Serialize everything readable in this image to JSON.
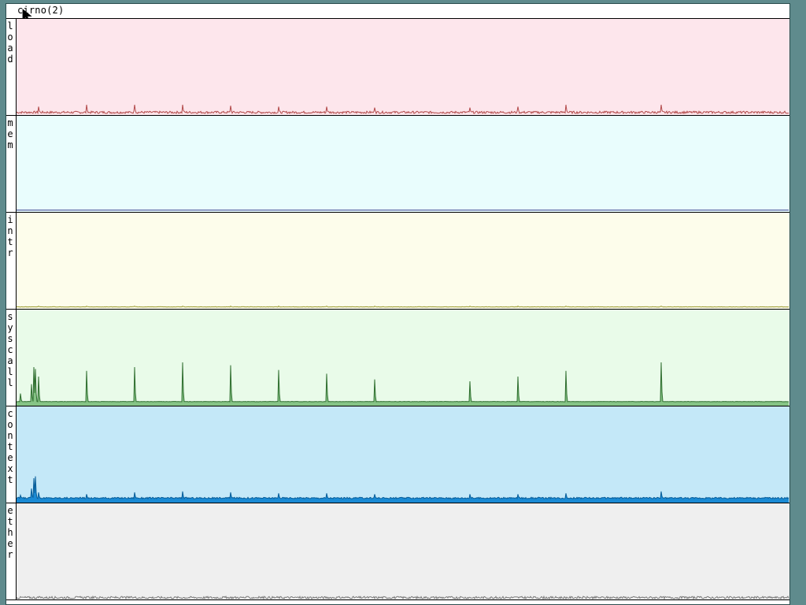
{
  "window": {
    "title": "cirno(2)"
  },
  "colors": {
    "desktop": "#5f8b8d",
    "load": {
      "bg": "#fde6ec",
      "line": "#b24a4a"
    },
    "mem": {
      "bg": "#e9fdfd",
      "line": "#3b3f8f"
    },
    "intr": {
      "bg": "#fdfdeb",
      "line": "#9a9a30"
    },
    "syscall": {
      "bg": "#e9fbe9",
      "line": "#2f6e2f",
      "fill": "#86c486"
    },
    "context": {
      "bg": "#c4e8f8",
      "line": "#0a5f9a",
      "fill": "#1a8ad4"
    },
    "ether": {
      "bg": "#efefef",
      "line": "#7a7a7a"
    }
  },
  "panels": [
    {
      "id": "load",
      "label": "load"
    },
    {
      "id": "mem",
      "label": "mem"
    },
    {
      "id": "intr",
      "label": "intr"
    },
    {
      "id": "syscall",
      "label": "syscall"
    },
    {
      "id": "context",
      "label": "context"
    },
    {
      "id": "ether",
      "label": "ether"
    }
  ],
  "chart_data": {
    "type": "area",
    "title": "cirno(2)",
    "series_count": 6,
    "x_samples": 982,
    "y_scale": "relative (0–1 of panel height)",
    "grid": false,
    "legend": "none",
    "series": [
      {
        "name": "load",
        "baseline": 0.02,
        "noise": 0.012,
        "spikes": [
          [
            28,
            0.08
          ],
          [
            89,
            0.1
          ],
          [
            150,
            0.1
          ],
          [
            211,
            0.1
          ],
          [
            272,
            0.09
          ],
          [
            333,
            0.08
          ],
          [
            394,
            0.08
          ],
          [
            455,
            0.07
          ],
          [
            576,
            0.07
          ],
          [
            637,
            0.08
          ],
          [
            698,
            0.1
          ],
          [
            819,
            0.1
          ]
        ]
      },
      {
        "name": "mem",
        "baseline": 0.01,
        "noise": 0.0,
        "spikes": []
      },
      {
        "name": "intr",
        "baseline": 0.012,
        "noise": 0.002,
        "spikes": [
          [
            28,
            0.02
          ],
          [
            89,
            0.02
          ],
          [
            150,
            0.02
          ],
          [
            211,
            0.02
          ],
          [
            272,
            0.02
          ],
          [
            333,
            0.02
          ],
          [
            394,
            0.02
          ],
          [
            455,
            0.02
          ],
          [
            576,
            0.02
          ],
          [
            637,
            0.02
          ],
          [
            698,
            0.02
          ],
          [
            819,
            0.02
          ]
        ]
      },
      {
        "name": "syscall",
        "baseline": 0.035,
        "noise": 0.002,
        "spikes": [
          [
            5,
            0.12
          ],
          [
            19,
            0.22
          ],
          [
            22,
            0.4
          ],
          [
            24,
            0.38
          ],
          [
            28,
            0.3
          ],
          [
            89,
            0.36
          ],
          [
            150,
            0.4
          ],
          [
            211,
            0.45
          ],
          [
            272,
            0.42
          ],
          [
            333,
            0.37
          ],
          [
            394,
            0.33
          ],
          [
            455,
            0.27
          ],
          [
            576,
            0.25
          ],
          [
            637,
            0.3
          ],
          [
            698,
            0.36
          ],
          [
            819,
            0.45
          ]
        ]
      },
      {
        "name": "context",
        "baseline": 0.04,
        "noise": 0.008,
        "spikes": [
          [
            5,
            0.07
          ],
          [
            19,
            0.14
          ],
          [
            22,
            0.25
          ],
          [
            24,
            0.27
          ],
          [
            28,
            0.1
          ],
          [
            89,
            0.08
          ],
          [
            150,
            0.1
          ],
          [
            211,
            0.11
          ],
          [
            272,
            0.1
          ],
          [
            333,
            0.09
          ],
          [
            394,
            0.09
          ],
          [
            455,
            0.08
          ],
          [
            576,
            0.08
          ],
          [
            637,
            0.08
          ],
          [
            698,
            0.09
          ],
          [
            819,
            0.11
          ]
        ]
      },
      {
        "name": "ether",
        "baseline": 0.012,
        "noise": 0.012,
        "spikes": []
      }
    ]
  }
}
